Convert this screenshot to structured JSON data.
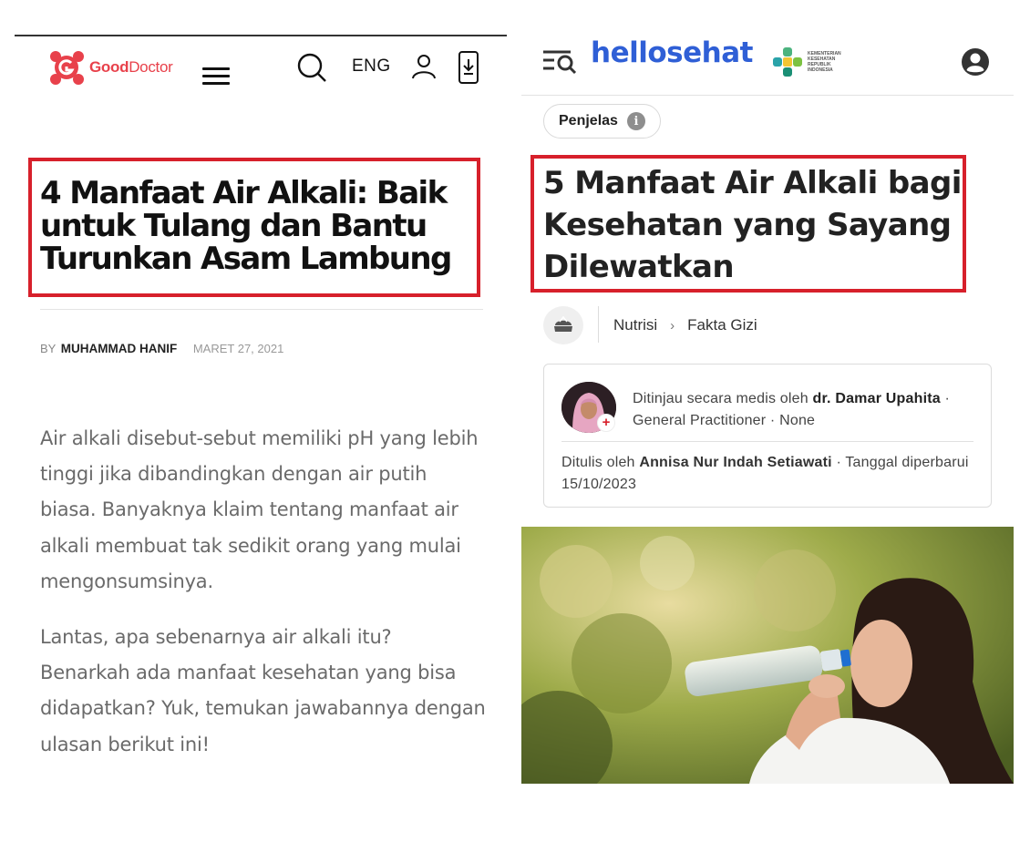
{
  "left": {
    "site": {
      "logo_brand": "Good",
      "logo_brand2": "Doctor"
    },
    "header": {
      "lang_label": "ENG"
    },
    "article": {
      "title": "4 Manfaat Air Alkali: Baik untuk Tulang dan Bantu Turunkan Asam Lambung",
      "by_label": "BY",
      "author": "MUHAMMAD HANIF",
      "date": "MARET 27, 2021",
      "paragraphs": [
        "Air alkali disebut-sebut memiliki pH yang lebih tinggi jika dibandingkan dengan air putih biasa. Banyaknya klaim tentang manfaat air alkali membuat tak sedikit orang yang mulai mengonsumsinya.",
        "Lantas, apa sebenarnya air alkali itu? Benarkah ada manfaat kesehatan yang bisa didapatkan? Yuk, temukan jawabannya dengan ulasan berikut ini!"
      ]
    },
    "colors": {
      "brand": "#e8414b",
      "highlight": "#d7202b"
    }
  },
  "right": {
    "site": {
      "logo": "hellosehat",
      "partner": "KEMENTERIAN KESEHATAN REPUBLIK INDONESIA"
    },
    "pill": {
      "label": "Penjelas",
      "info_glyph": "i"
    },
    "article": {
      "title": "5 Manfaat Air Alkali bagi Kesehatan yang Sayang Dilewatkan",
      "breadcrumb": [
        "Nutrisi",
        "Fakta Gizi"
      ],
      "reviewed_prefix": "Ditinjau secara medis oleh",
      "reviewer": "dr. Damar Upahita",
      "reviewer_meta": "· General Practitioner · None",
      "written_prefix": "Ditulis oleh",
      "writer": "Annisa Nur Indah Setiawati",
      "written_suffix": "· Tanggal diperbarui 15/10/2023"
    },
    "colors": {
      "brand": "#2f5fd6",
      "highlight": "#d7202b"
    }
  }
}
